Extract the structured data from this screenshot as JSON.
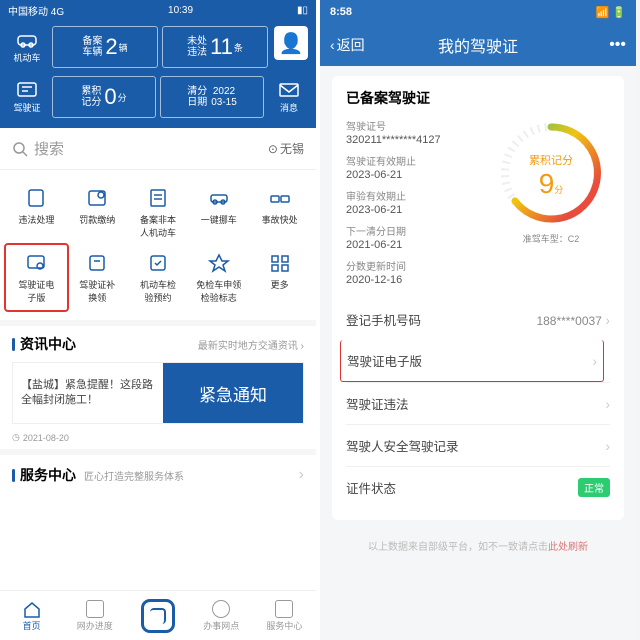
{
  "left": {
    "status": {
      "carrier": "中国移动  4G",
      "time": "10:39"
    },
    "nav": {
      "icon1": "机动车",
      "icon2": "驾驶证",
      "card_vehicle_label": "备案\n车辆",
      "card_vehicle_num": "2",
      "card_vehicle_unit": "辆",
      "card_violation_label": "未处\n违法",
      "card_violation_num": "11",
      "card_violation_unit": "条",
      "card_points_label": "累积\n记分",
      "card_points_num": "0",
      "card_points_unit": "分",
      "card_reset_label": "清分\n日期",
      "card_reset_val": "2022\n03-15",
      "msg": "消息"
    },
    "search": {
      "placeholder": "搜索",
      "city": "无锡"
    },
    "grid_row1": [
      "违法处理",
      "罚款缴纳",
      "备案非本\n人机动车",
      "一键挪车",
      "事故快处"
    ],
    "grid_row2": [
      "驾驶证电\n子版",
      "驾驶证补\n换领",
      "机动车检\n验预约",
      "免检车申领\n检验标志",
      "更多"
    ],
    "news": {
      "title": "资讯中心",
      "sub": "最新实时地方交通资讯",
      "card_title": "【盐城】紧急提醒！这段路全幅封闭施工！",
      "banner": "紧急通知",
      "ts": "2021-08-20"
    },
    "service": {
      "title": "服务中心",
      "sub": "匠心打造完整服务体系"
    },
    "tabs": [
      "首页",
      "网办进度",
      "扫一扫",
      "办事网点",
      "服务中心"
    ]
  },
  "right": {
    "status": {
      "time": "8:58"
    },
    "nav": {
      "back": "返回",
      "title": "我的驾驶证"
    },
    "card_title": "已备案驾驶证",
    "info": {
      "license_no_label": "驾驶证号",
      "license_no": "320211********4127",
      "valid_until_label": "驾驶证有效期止",
      "valid_until": "2023-06-21",
      "review_valid_label": "审验有效期止",
      "review_valid": "2023-06-21",
      "next_reset_label": "下一清分日期",
      "next_reset": "2021-06-21",
      "score_update_label": "分数更新时间",
      "score_update": "2020-12-16"
    },
    "gauge": {
      "label": "累积记分",
      "value": "9",
      "unit": "分",
      "class_label": "准驾车型：",
      "class_val": "C2"
    },
    "rows": {
      "phone_label": "登记手机号码",
      "phone_val": "188****0037",
      "electronic": "驾驶证电子版",
      "violations": "驾驶证违法",
      "record": "驾驶人安全驾驶记录",
      "status_label": "证件状态",
      "status_val": "正常"
    },
    "footer_text": "以上数据来自部级平台，如不一致请点击",
    "footer_link": "此处刷新"
  }
}
